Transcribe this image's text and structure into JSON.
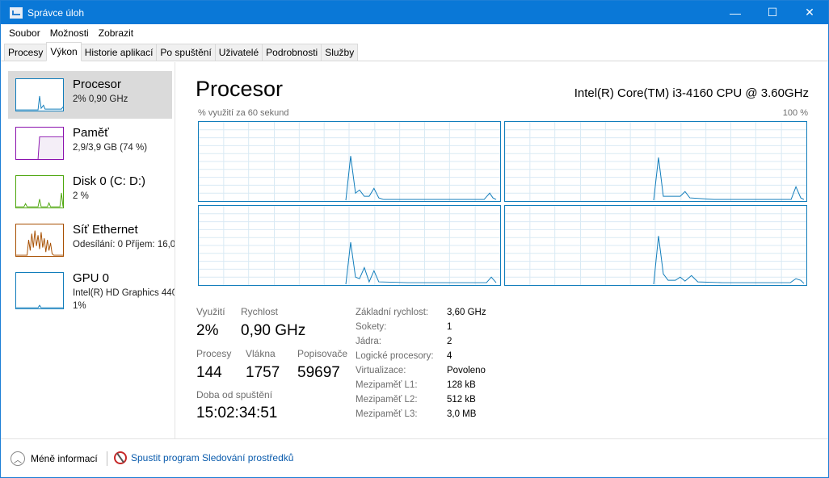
{
  "window": {
    "title": "Správce úloh",
    "controls": {
      "minimize": "—",
      "maximize": "☐",
      "close": "✕"
    }
  },
  "menu": [
    "Soubor",
    "Možnosti",
    "Zobrazit"
  ],
  "tabs": [
    {
      "label": "Procesy",
      "active": false
    },
    {
      "label": "Výkon",
      "active": true
    },
    {
      "label": "Historie aplikací",
      "active": false
    },
    {
      "label": "Po spuštění",
      "active": false
    },
    {
      "label": "Uživatelé",
      "active": false
    },
    {
      "label": "Podrobnosti",
      "active": false
    },
    {
      "label": "Služby",
      "active": false
    }
  ],
  "sidebar": {
    "items": [
      {
        "name": "Procesor",
        "sub": "2% 0,90 GHz",
        "color": "#117dbb",
        "selected": true
      },
      {
        "name": "Paměť",
        "sub": "2,9/3,9 GB (74 %)",
        "color": "#8b12ae",
        "selected": false
      },
      {
        "name": "Disk 0 (C: D:)",
        "sub": "2 %",
        "color": "#4da60c",
        "selected": false
      },
      {
        "name": "Síť Ethernet",
        "sub": "Odesílání: 0 Příjem: 16,0",
        "color": "#a74f01",
        "selected": false
      },
      {
        "name": "GPU 0",
        "sub": "Intel(R) HD Graphics 440",
        "sub2": "1%",
        "color": "#117dbb",
        "selected": false
      }
    ]
  },
  "main": {
    "heading": "Procesor",
    "cpu_model": "Intel(R) Core(TM) i3-4160 CPU @ 3.60GHz",
    "graph_caption": "% využití za 60 sekund",
    "graph_max": "100 %",
    "graph_color": "#117dbb",
    "stats": {
      "utilization_label": "Využití",
      "utilization": "2%",
      "speed_label": "Rychlost",
      "speed": "0,90 GHz",
      "processes_label": "Procesy",
      "processes": "144",
      "threads_label": "Vlákna",
      "threads": "1757",
      "handles_label": "Popisovače",
      "handles": "59697",
      "uptime_label": "Doba od spuštění",
      "uptime": "15:02:34:51"
    },
    "info": [
      {
        "key": "Základní rychlost:",
        "value": "3,60 GHz"
      },
      {
        "key": "Sokety:",
        "value": "1"
      },
      {
        "key": "Jádra:",
        "value": "2"
      },
      {
        "key": "Logické procesory:",
        "value": "4"
      },
      {
        "key": "Virtualizace:",
        "value": "Povoleno"
      },
      {
        "key": "Mezipaměť L1:",
        "value": "128 kB"
      },
      {
        "key": "Mezipaměť L2:",
        "value": "512 kB"
      },
      {
        "key": "Mezipaměť L3:",
        "value": "3,0 MB"
      }
    ]
  },
  "footer": {
    "less_info": "Méně informací",
    "resource_monitor": "Spustit program Sledování prostředků"
  }
}
